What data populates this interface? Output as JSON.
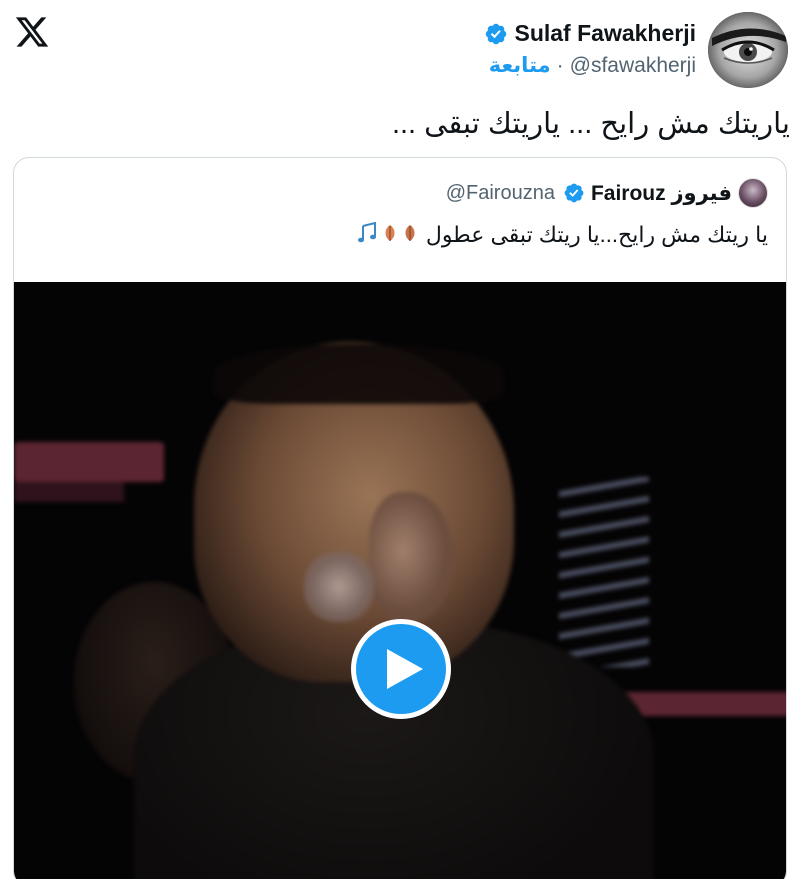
{
  "app": {
    "logo": "x-logo-icon"
  },
  "author": {
    "display_name": "Sulaf Fawakherji",
    "handle": "@sfawakherji",
    "separator": "·",
    "follow_label": "متابعة",
    "verified_icon": "verified-badge-icon",
    "avatar": "avatar-eye-closeup"
  },
  "tweet": {
    "text": "ياريتك مش رايح ... ياريتك تبقى ..."
  },
  "quote": {
    "display_name": "Fairouz فيروز",
    "handle": "@Fairouzna",
    "text": "يا ريتك مش رايح...يا ريتك تبقى عطول",
    "emojis": [
      "fallen-leaf-icon",
      "fallen-leaf-icon",
      "musical-notes-icon"
    ],
    "verified_icon": "verified-badge-icon"
  },
  "video": {
    "play_icon": "play-icon"
  },
  "colors": {
    "accent": "#1d9bf0",
    "text": "#0f1419",
    "muted": "#536471",
    "border": "#cfd9de"
  }
}
